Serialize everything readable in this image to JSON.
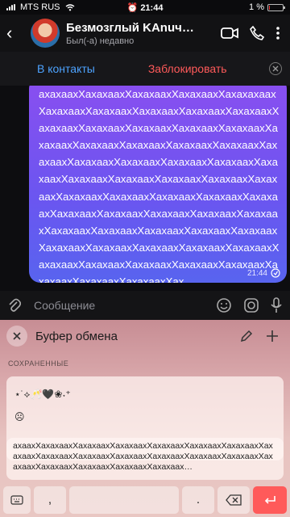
{
  "status_bar": {
    "carrier": "MTS RUS",
    "time": "21:44",
    "battery": "1 %",
    "battery_level_fraction": 0.01
  },
  "header": {
    "contact_name": "Безмозглый KAnuчикКАnuч…",
    "contact_status": "Был(-а) недавно",
    "icons": [
      "back-icon",
      "video-call-icon",
      "phone-icon",
      "more-icon"
    ]
  },
  "banner": {
    "add_contact_label": "В контакты",
    "block_label": "Заблокировать"
  },
  "message": {
    "text": "axaxaaxXaxaxaaxXaxaxaaxXaxaxaaxXaxaxaxaaxXaxaxaaxXaxaxaaxXaxaxaaxXaxaxaaxXaxaxaaxXaxaxaaxXaxaxaaxXaxaxaaxXaxaxaaxXaxaxaaxXaxaxaaxXaxaxaaxXaxaxaaxXaxaxaaxXaxaxaaxXaxaxaaxXaxaxaaxXaxaxaaxXaxaxaaxXaxaxaaxXaxaxaaxXaxaxaaxXaxaxaaxXaxaxaaxXaxaxaaxXaxaxaaxXaxaxaaxXaxaxaaxXaxaxaaxXaxaxaaxXaxaxaaxXaxaxaaxXaxaxaaxXaxaxaaxXaxaxaaxXaxaxaaxXaxaxaaxXaxaxaaxXaxaxaaxXaxaxaaxXaxaxaaxXaxaxaaxXaxaxaaxXaxaxaaxXaxaxaaxXaxaxaaxXaxaxaaxXaxaxaaxXaxaxaaxXaxaxaaxXaxaxaaxXaxaxaaxXaxaxaaxXaxaxaaxXax",
    "time": "21:44"
  },
  "composer": {
    "placeholder": "Сообщение"
  },
  "clipboard": {
    "title": "Буфер обмена",
    "section_label": "СОХРАНЕННЫЕ",
    "item1_line1": "⋆˙⟡🥂🖤❀˖⁺",
    "item1_line2": "☹",
    "item2_text": "axaaxXaxaxaaxXaxaxaaxXaxaxaaxXaxaxaaxXaxaxaaxXaxaxaaxXaxaxaaxXaxaxaaxXaxaxaaxXaxaxaaxXaxaxaaxXaxaxaaxXaxaxaaxXaxaxaaxXaxaxaaxXaxaxaaxXaxaxaaxXaxaxaax…"
  },
  "keyboard": {
    "comma": ",",
    "period": "."
  }
}
